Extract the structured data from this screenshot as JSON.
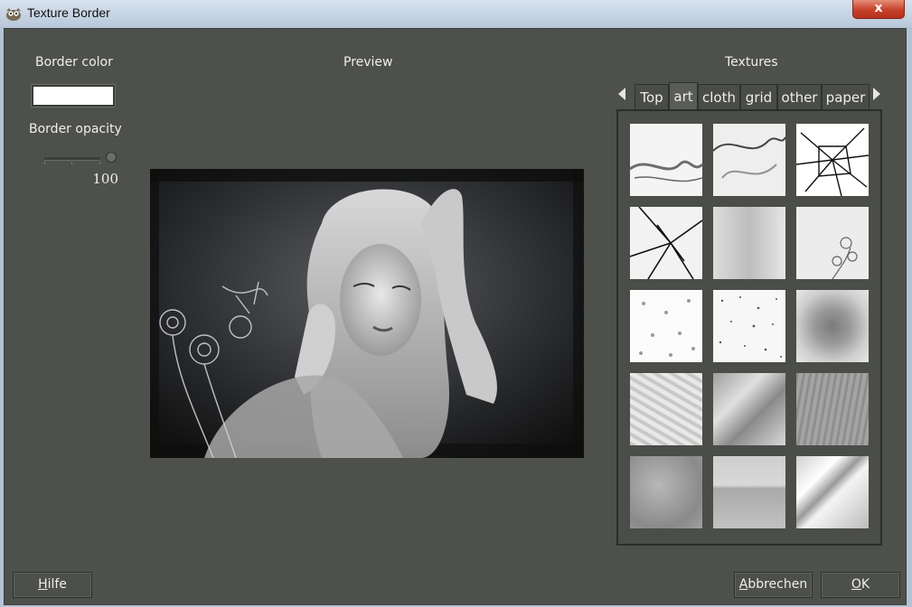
{
  "window": {
    "title": "Texture Border",
    "close_glyph": "x"
  },
  "left_panel": {
    "border_color_label": "Border color",
    "border_color_value": "#ffffff",
    "border_opacity_label": "Border opacity",
    "border_opacity_value": "100"
  },
  "preview": {
    "label": "Preview"
  },
  "textures": {
    "label": "Textures",
    "tabs": [
      {
        "label": "Top",
        "active": false
      },
      {
        "label": "art",
        "active": true
      },
      {
        "label": "cloth",
        "active": false
      },
      {
        "label": "grid",
        "active": false
      },
      {
        "label": "other",
        "active": false
      },
      {
        "label": "paper",
        "active": false
      }
    ]
  },
  "buttons": {
    "help_mnemonic": "H",
    "help_rest": "ilfe",
    "cancel_mnemonic": "A",
    "cancel_rest": "bbrechen",
    "ok_mnemonic": "O",
    "ok_rest": "K"
  },
  "icons": {
    "app": "gimp-icon",
    "close": "close-icon",
    "tabs_prev": "chevron-left-icon",
    "tabs_next": "chevron-right-icon"
  }
}
